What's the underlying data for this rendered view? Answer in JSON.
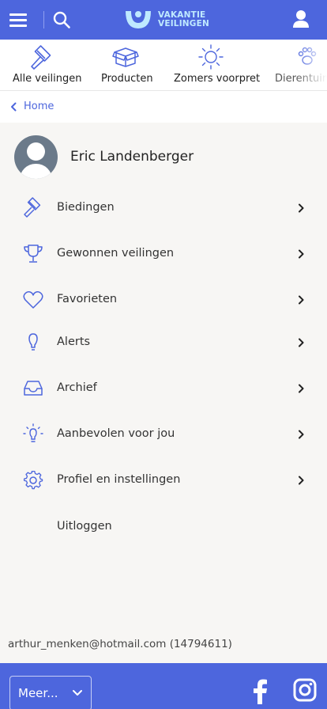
{
  "header": {
    "logo_line1": "VAKANTIE",
    "logo_line2": "VEILINGEN",
    "colors": {
      "primary": "#4d66dd",
      "logo_text": "#bfe9ff"
    }
  },
  "categories": [
    {
      "label": "Alle veilingen",
      "icon": "gavel-icon"
    },
    {
      "label": "Producten",
      "icon": "box-icon"
    },
    {
      "label": "Zomers voorpret",
      "icon": "sun-icon"
    },
    {
      "label": "Dierentuin",
      "icon": "paw-icon"
    }
  ],
  "breadcrumb": {
    "label": "Home"
  },
  "profile": {
    "name": "Eric Landenberger"
  },
  "menu": [
    {
      "label": "Biedingen",
      "icon": "gavel-icon"
    },
    {
      "label": "Gewonnen veilingen",
      "icon": "trophy-icon"
    },
    {
      "label": "Favorieten",
      "icon": "heart-icon"
    },
    {
      "label": "Alerts",
      "icon": "lightbulb-alert-icon"
    },
    {
      "label": "Archief",
      "icon": "inbox-icon"
    },
    {
      "label": "Aanbevolen voor jou",
      "icon": "bulb-icon"
    },
    {
      "label": "Profiel en instellingen",
      "icon": "gear-icon"
    },
    {
      "label": "Uitloggen"
    }
  ],
  "account": {
    "text": "arthur_menken@hotmail.com (14794611)"
  },
  "footer": {
    "more_label": "Meer..."
  }
}
